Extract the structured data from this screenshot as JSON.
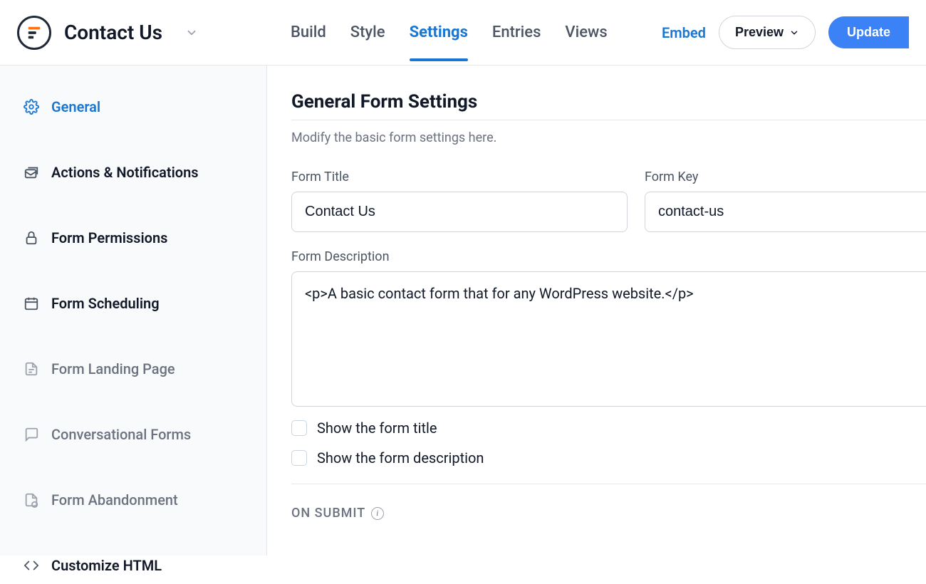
{
  "header": {
    "page_title": "Contact Us",
    "tabs": [
      "Build",
      "Style",
      "Settings",
      "Entries",
      "Views"
    ],
    "active_tab_index": 2,
    "embed_label": "Embed",
    "preview_label": "Preview",
    "update_label": "Update"
  },
  "sidebar": {
    "items": [
      {
        "label": "General",
        "icon": "gear-icon",
        "state": "active"
      },
      {
        "label": "Actions & Notifications",
        "icon": "envelope-stack-icon",
        "state": "normal"
      },
      {
        "label": "Form Permissions",
        "icon": "lock-icon",
        "state": "normal"
      },
      {
        "label": "Form Scheduling",
        "icon": "calendar-icon",
        "state": "normal"
      },
      {
        "label": "Form Landing Page",
        "icon": "page-icon",
        "state": "muted"
      },
      {
        "label": "Conversational Forms",
        "icon": "chat-icon",
        "state": "muted"
      },
      {
        "label": "Form Abandonment",
        "icon": "page-abandon-icon",
        "state": "muted"
      },
      {
        "label": "Customize HTML",
        "icon": "code-icon",
        "state": "normal"
      }
    ]
  },
  "main": {
    "section_title": "General Form Settings",
    "section_desc": "Modify the basic form settings here.",
    "form_title_label": "Form Title",
    "form_title_value": "Contact Us",
    "form_key_label": "Form Key",
    "form_key_value": "contact-us",
    "form_desc_label": "Form Description",
    "form_desc_value": "<p>A basic contact form that for any WordPress website.</p>",
    "show_title_label": "Show the form title",
    "show_desc_label": "Show the form description",
    "on_submit_label": "ON SUBMIT"
  }
}
